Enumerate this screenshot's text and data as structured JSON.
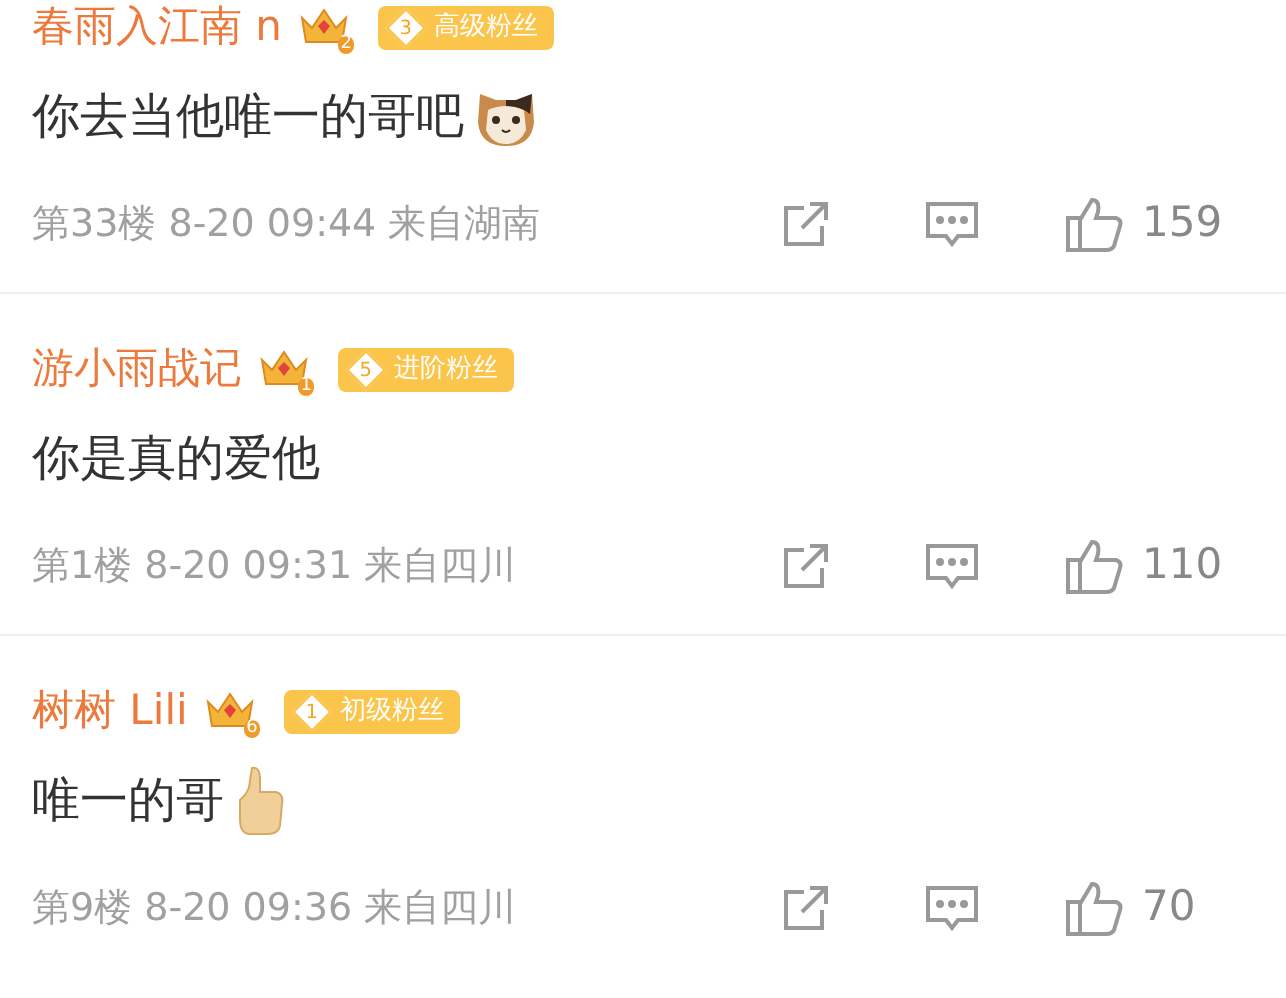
{
  "comments": [
    {
      "name": "春雨入江南 n",
      "crown_level": "2",
      "fan_level": "3",
      "fan_title": "高级粉丝",
      "text": "你去当他唯一的哥吧",
      "kind": "cat",
      "floor": "第33楼",
      "time": "8-20 09:44",
      "location": "来自湖南",
      "likes": "159"
    },
    {
      "name": "游小雨战记",
      "crown_level": "1",
      "fan_level": "5",
      "fan_title": "进阶粉丝",
      "text": "你是真的爱他",
      "kind": "plain",
      "floor": "第1楼",
      "time": "8-20 09:31",
      "location": "来自四川",
      "likes": "110"
    },
    {
      "name": "树树 Lili",
      "crown_level": "6",
      "fan_level": "1",
      "fan_title": "初级粉丝",
      "text": "唯一的哥",
      "kind": "thumb",
      "floor": "第9楼",
      "time": "8-20 09:36",
      "location": "来自四川",
      "likes": "70"
    }
  ]
}
